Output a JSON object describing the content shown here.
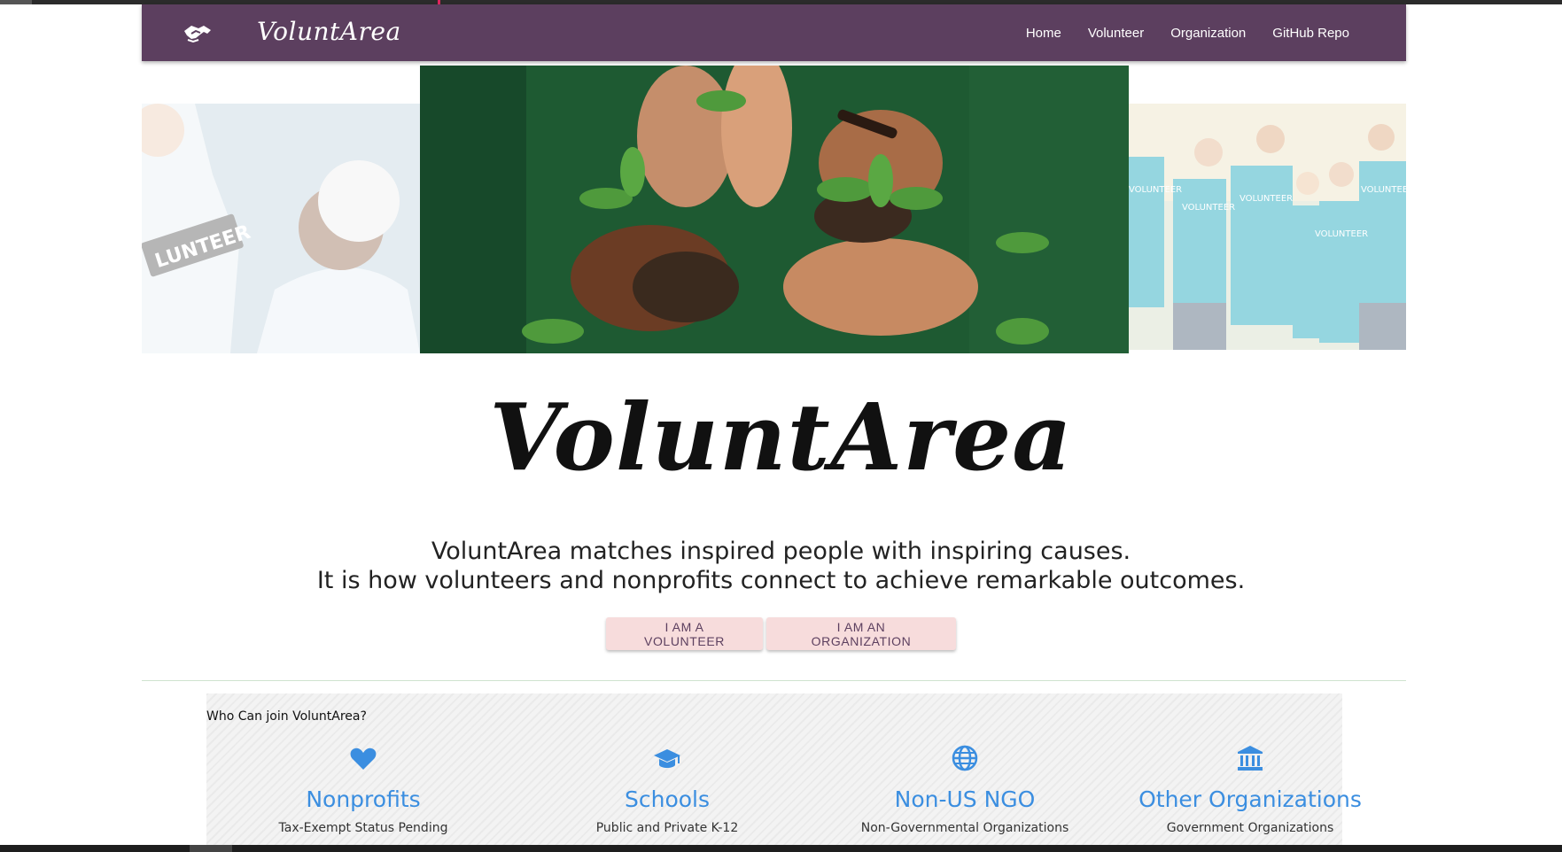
{
  "brand": {
    "name": "VoluntArea",
    "icon": "handshake-icon"
  },
  "nav": {
    "items": [
      {
        "label": "Home"
      },
      {
        "label": "Volunteer"
      },
      {
        "label": "Organization"
      },
      {
        "label": "GitHub Repo"
      }
    ]
  },
  "hero": {
    "photos": {
      "left_badge": "LUNTEER",
      "right_shirts": [
        "VOLUNTEER",
        "VOLUNTEER",
        "VOLUNTEER",
        "VOLUNTEER",
        "VOLUNTEER"
      ]
    },
    "title": "VoluntArea",
    "tagline_line1": "VoluntArea matches inspired people with inspiring causes.",
    "tagline_line2": "It is how volunteers and nonprofits connect to achieve remarkable outcomes.",
    "buttons": {
      "volunteer": "I AM A VOLUNTEER",
      "organization": "I AM AN ORGANIZATION"
    }
  },
  "who": {
    "title": "Who Can join VoluntArea?",
    "categories": [
      {
        "icon": "heart-icon",
        "title": "Nonprofits",
        "subtitle": "Tax-Exempt Status Pending"
      },
      {
        "icon": "graduation-cap-icon",
        "title": "Schools",
        "subtitle": "Public and Private K-12"
      },
      {
        "icon": "globe-icon",
        "title": "Non-US NGO",
        "subtitle": "Non-Governmental Organizations"
      },
      {
        "icon": "institution-icon",
        "title": "Other Organizations",
        "subtitle": "Government Organizations"
      }
    ]
  },
  "colors": {
    "navbar": "#5c3f5f",
    "accent": "#3b8ee0",
    "button_bg": "#f7dcdc",
    "button_text": "#5c3f5f"
  }
}
